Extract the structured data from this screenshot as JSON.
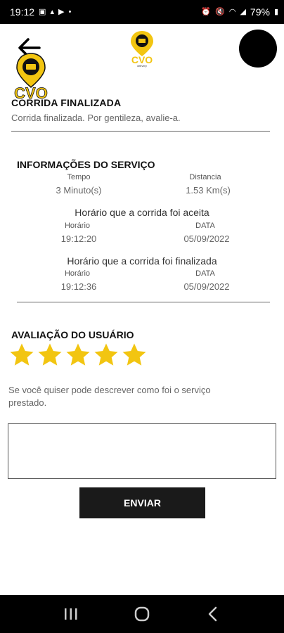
{
  "status_bar": {
    "time": "19:12",
    "battery": "79%",
    "left_icons": [
      "image-icon",
      "notification-icon",
      "youtube-icon",
      "dot-icon"
    ],
    "right_icons": [
      "alarm-icon",
      "mute-icon",
      "wifi-icon",
      "signal-icon",
      "battery-icon"
    ]
  },
  "colors": {
    "accent": "#f2c511",
    "dark": "#1a1a1a",
    "divider": "#666666"
  },
  "header": {
    "back_icon": "arrow-left-icon",
    "logo_icon": "cvo-logo-icon",
    "avatar_icon": "avatar"
  },
  "ride": {
    "title": "CORRIDA FINALIZADA",
    "subtitle": "Corrida finalizada. Por gentileza, avalie-a."
  },
  "service_info": {
    "title": "INFORMAÇÕES DO SERVIÇO",
    "time_label": "Tempo",
    "time_value": "3 Minuto(s)",
    "distance_label": "Distancia",
    "distance_value": "1.53 Km(s)",
    "accepted_heading": "Horário que a corrida foi aceita",
    "accepted_time_label": "Horário",
    "accepted_time_value": "19:12:20",
    "accepted_date_label": "DATA",
    "accepted_date_value": "05/09/2022",
    "finished_heading": "Horário que a corrida foi finalizada",
    "finished_time_label": "Horário",
    "finished_time_value": "19:12:36",
    "finished_date_label": "DATA",
    "finished_date_value": "05/09/2022"
  },
  "rating": {
    "title": "AVALIAÇÃO DO USUÁRIO",
    "stars_selected": 5,
    "stars_total": 5,
    "hint": "Se você quiser pode descrever como foi o serviço prestado.",
    "comment_value": "",
    "send_label": "ENVIAR"
  },
  "nav_bar": {
    "items": [
      "recents-icon",
      "home-icon",
      "back-icon"
    ]
  }
}
